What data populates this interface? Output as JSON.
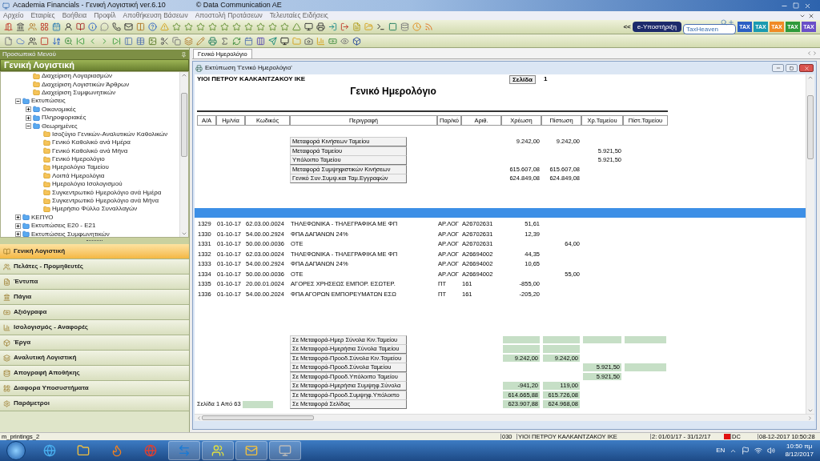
{
  "window": {
    "title": "Academia Financials - Γενική Λογιστική ver.6.10",
    "copyright": "© Data Communication AE"
  },
  "menu": [
    "Αρχείο",
    "Εταιρίες",
    "Βοήθεια",
    "Προφίλ",
    "Αποθήκευση Βάσεων",
    "Αποστολή Προτάσεων",
    "Τελευταίες Ειδήσεις"
  ],
  "toolbar_links": {
    "collapse": "<<",
    "support_button": "e-Υποστήριξη",
    "search": {
      "value": "TaxHeaven"
    },
    "tax_badges": [
      {
        "label": "TAX",
        "color": "#2a5fc4"
      },
      {
        "label": "TAX",
        "color": "#1a9bb0"
      },
      {
        "label": "TAX",
        "color": "#f08a24"
      },
      {
        "label": "TAX",
        "color": "#2e9a3a"
      },
      {
        "label": "TAX",
        "color": "#6a4fc8"
      }
    ]
  },
  "side_panel": {
    "header": "Προσωπικό Μενού",
    "module_title": "Γενική Λογιστική",
    "tree": [
      {
        "children": [
          {
            "kind": "item",
            "label": "Διαχείριση Λογαριασμών"
          },
          {
            "kind": "item",
            "label": "Διαχείριση Λογιστικών Άρθρων"
          },
          {
            "kind": "item",
            "label": "Διαχείριση Συμφωνητικών"
          }
        ]
      },
      {
        "kind": "folder",
        "label": "Εκτυπώσεις",
        "expanded": true,
        "children": [
          {
            "kind": "folder",
            "label": "Οικονομικές",
            "expanded": false
          },
          {
            "kind": "folder",
            "label": "Πληροφοριακές",
            "expanded": false
          },
          {
            "kind": "folder",
            "label": "Θεωρημένες",
            "expanded": true,
            "children": [
              {
                "kind": "item",
                "label": "Ισοζύγιο Γενικών-Αναλυτικών Καθολικών"
              },
              {
                "kind": "item",
                "label": "Γενικό Καθολικό ανά Ημέρα"
              },
              {
                "kind": "item",
                "label": "Γενικό Καθολικό ανά Μήνα"
              },
              {
                "kind": "item",
                "label": "Γενικό Ημερολόγιο"
              },
              {
                "kind": "item",
                "label": "Ημερολόγιο Ταμείου"
              },
              {
                "kind": "item",
                "label": "Λοιπά Ημερολόγια"
              },
              {
                "kind": "item",
                "label": "Ημερολόγιο Ισολογισμού"
              },
              {
                "kind": "item",
                "label": "Συγκεντρωτικό Ημερολόγιο ανά Ημέρα"
              },
              {
                "kind": "item",
                "label": "Συγκεντρωτικό Ημερολόγιο ανά Μήνα"
              },
              {
                "kind": "item",
                "label": "Ημερήσιο Φύλλο Συναλλαγών"
              }
            ]
          }
        ]
      },
      {
        "kind": "folder",
        "label": "ΚΕΠΥΟ",
        "expanded": false
      },
      {
        "kind": "folder",
        "label": "Εκτυπώσεις Ε20 - Ε21",
        "expanded": false
      },
      {
        "kind": "folder",
        "label": "Εκτυπώσεις Συμφωνητικών",
        "expanded": false
      }
    ],
    "nav": [
      {
        "label": "Γενική Λογιστική",
        "selected": true
      },
      {
        "label": "Πελάτες - Προμηθευτές",
        "selected": false
      },
      {
        "label": "Έντυπα",
        "selected": false
      },
      {
        "label": "Πάγια",
        "selected": false
      },
      {
        "label": "Αξιόγραφα",
        "selected": false
      },
      {
        "label": "Ισολογισμός - Αναφορές",
        "selected": false
      },
      {
        "label": "Έργα",
        "selected": false
      },
      {
        "label": "Αναλυτική Λογιστική",
        "selected": false
      },
      {
        "label": "Απογραφή Αποθήκης",
        "selected": false
      },
      {
        "label": "Διαφορα Υποσυστήματα",
        "selected": false
      },
      {
        "label": "Παράμετροι",
        "selected": false
      }
    ]
  },
  "document_tab": {
    "label": "Γενικό Ημερολόγιο",
    "selected": true
  },
  "print_window": {
    "title": "Εκτύπωση 'Γενικό Ημερολόγιο'",
    "report": {
      "company": "ΥΙΟΙ ΠΕΤΡΟΥ ΚΑΛΚΑΝΤΖΑΚΟΥ ΙΚΕ",
      "page_label": "Σελίδα",
      "page_number": "1",
      "title": "Γενικό Ημερολόγιο",
      "columns": [
        "Α/Α",
        "Ημ/νία",
        "Κωδικός",
        "Περιγραφή",
        "Παρ/κό",
        "Αριθ.",
        "Χρέωση",
        "Πίστωση",
        "Χρ.Ταμείου",
        "Πίστ.Ταμείου"
      ],
      "carry_forward": [
        {
          "label": "Μεταφορά Κινήσεων Ταμείου",
          "debit": "9.242,00",
          "credit": "9.242,00"
        },
        {
          "label": "Μεταφορά Ταμείου",
          "cash_debit": "5.921,50"
        },
        {
          "label": "Υπόλοιπο Ταμείου",
          "cash_debit": "5.921,50"
        },
        {
          "label": "Μεταφορά Συμψηφιστικών Κινήσεων",
          "debit": "615.607,08",
          "credit": "615.607,08"
        },
        {
          "label": "Γενικό Συν.Συμψ.και Ταμ.Εγγραφών",
          "debit": "624.849,08",
          "credit": "624.849,08"
        }
      ],
      "entries": [
        {
          "no": "1329",
          "date": "01-10-17",
          "code": "62.03.00.0024",
          "description": "ΤΗΛΕΦΩΝΙΚΑ - ΤΗΛΕΓΡΑΦΙΚΑ ΜΕ ΦΠ",
          "ref": "ΑΡ.ΛΟΓ",
          "number": "A26702631",
          "debit": "51,61"
        },
        {
          "no": "1330",
          "date": "01-10-17",
          "code": "54.00.00.2924",
          "description": "ΦΠΑ ΔΑΠΑΝΩΝ 24%",
          "ref": "ΑΡ.ΛΟΓ",
          "number": "A26702631",
          "debit": "12,39"
        },
        {
          "no": "1331",
          "date": "01-10-17",
          "code": "50.00.00.0036",
          "description": "ΟΤΕ",
          "ref": "ΑΡ.ΛΟΓ",
          "number": "A26702631",
          "credit": "64,00"
        },
        {
          "no": "1332",
          "date": "01-10-17",
          "code": "62.03.00.0024",
          "description": "ΤΗΛΕΦΩΝΙΚΑ - ΤΗΛΕΓΡΑΦΙΚΑ ΜΕ ΦΠ",
          "ref": "ΑΡ.ΛΟΓ",
          "number": "A26694002",
          "debit": "44,35"
        },
        {
          "no": "1333",
          "date": "01-10-17",
          "code": "54.00.00.2924",
          "description": "ΦΠΑ ΔΑΠΑΝΩΝ 24%",
          "ref": "ΑΡ.ΛΟΓ",
          "number": "A26694002",
          "debit": "10,65"
        },
        {
          "no": "1334",
          "date": "01-10-17",
          "code": "50.00.00.0036",
          "description": "ΟΤΕ",
          "ref": "ΑΡ.ΛΟΓ",
          "number": "A26694002",
          "credit": "55,00"
        },
        {
          "no": "1335",
          "date": "01-10-17",
          "code": "20.00.01.0024",
          "description": "ΑΓΟΡΕΣ ΧΡΗΣΕΩΣ ΕΜΠΟΡ. ΕΣΩΤΕΡ.",
          "ref": "ΠΤ",
          "number": "161",
          "debit": "-855,00"
        },
        {
          "no": "1336",
          "date": "01-10-17",
          "code": "54.00.00.2024",
          "description": "ΦΠΑ ΑΓΟΡΩΝ ΕΜΠΟΡΕΥΜΑΤΩΝ ΕΣΩ",
          "ref": "ΠΤ",
          "number": "161",
          "debit": "-205,20"
        }
      ],
      "totals": [
        {
          "label": "Σε Μεταφορά-Ημερ Σύνολα Κιν.Ταμείου",
          "debit": {
            "shaded": true
          },
          "credit": {
            "shaded": true
          },
          "cash_debit": {
            "shaded": true
          },
          "cash_credit": {
            "shaded": true
          }
        },
        {
          "label": "Σε Μεταφορά-Ημερήσια Σύνολα Ταμείου",
          "debit": {
            "shaded": true
          },
          "credit": {
            "shaded": true
          }
        },
        {
          "label": "Σε Μεταφορά-Προοδ.Σύνολα Κιν.Ταμείου",
          "debit": {
            "value": "9.242,00",
            "shaded": true
          },
          "credit": {
            "value": "9.242,00",
            "shaded": true
          }
        },
        {
          "label": "Σε Μεταφορά-Προοδ.Σύνολα Ταμείου",
          "cash_debit": {
            "value": "5.921,50",
            "shaded": true
          },
          "cash_credit": {
            "shaded": true
          }
        },
        {
          "label": "Σε Μεταφορά-Προοδ.Υπόλοιπο Ταμείου",
          "cash_debit": {
            "value": "5.921,50",
            "shaded": true
          }
        },
        {
          "label": "Σε Μεταφορά-Ημερήσια Συμψηφ.Σύνολα",
          "debit": {
            "value": "-941,20",
            "shaded": true
          },
          "credit": {
            "value": "119,00",
            "shaded": true
          }
        },
        {
          "label": "Σε Μεταφορά-Προοδ.Συμψηφ.Υπόλοιπο",
          "debit": {
            "value": "614.665,88",
            "shaded": true
          },
          "credit": {
            "value": "615.726,08",
            "shaded": true
          }
        },
        {
          "label": "Σε Μεταφορά Σελίδας",
          "debit": {
            "value": "623.907,88",
            "shaded": true
          },
          "credit": {
            "value": "624.968,08",
            "shaded": true
          }
        }
      ],
      "page_info": "Σελίδα 1 Από 63"
    }
  },
  "status_bar": {
    "form": "m_printings_2",
    "company_code": "030",
    "company": "ΥΙΟΙ ΠΕΤΡΟΥ ΚΑΛΚΑΝΤΖΑΚΟΥ ΙΚΕ",
    "period": "2: 01/01/17 - 31/12/17",
    "connection": "DC",
    "datetime": "08-12-2017 10:50:28"
  },
  "taskbar": {
    "language": "EN",
    "time": "10:50 πμ",
    "date": "8/12/2017"
  }
}
